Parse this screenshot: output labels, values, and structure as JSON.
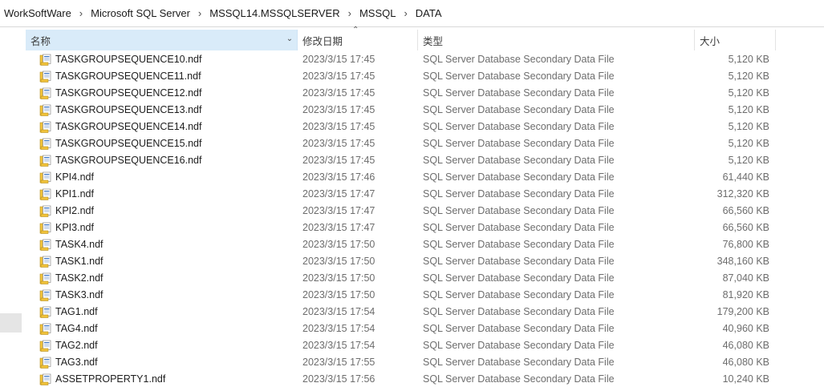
{
  "breadcrumb": [
    "WorkSoftWare",
    "Microsoft SQL Server",
    "MSSQL14.MSSQLSERVER",
    "MSSQL",
    "DATA"
  ],
  "columns": {
    "name": "名称",
    "date": "修改日期",
    "type": "类型",
    "size": "大小"
  },
  "files": [
    {
      "name": "TASKGROUPSEQUENCE10.ndf",
      "date": "2023/3/15 17:45",
      "type": "SQL Server Database Secondary Data File",
      "size": "5,120 KB"
    },
    {
      "name": "TASKGROUPSEQUENCE11.ndf",
      "date": "2023/3/15 17:45",
      "type": "SQL Server Database Secondary Data File",
      "size": "5,120 KB"
    },
    {
      "name": "TASKGROUPSEQUENCE12.ndf",
      "date": "2023/3/15 17:45",
      "type": "SQL Server Database Secondary Data File",
      "size": "5,120 KB"
    },
    {
      "name": "TASKGROUPSEQUENCE13.ndf",
      "date": "2023/3/15 17:45",
      "type": "SQL Server Database Secondary Data File",
      "size": "5,120 KB"
    },
    {
      "name": "TASKGROUPSEQUENCE14.ndf",
      "date": "2023/3/15 17:45",
      "type": "SQL Server Database Secondary Data File",
      "size": "5,120 KB"
    },
    {
      "name": "TASKGROUPSEQUENCE15.ndf",
      "date": "2023/3/15 17:45",
      "type": "SQL Server Database Secondary Data File",
      "size": "5,120 KB"
    },
    {
      "name": "TASKGROUPSEQUENCE16.ndf",
      "date": "2023/3/15 17:45",
      "type": "SQL Server Database Secondary Data File",
      "size": "5,120 KB"
    },
    {
      "name": "KPI4.ndf",
      "date": "2023/3/15 17:46",
      "type": "SQL Server Database Secondary Data File",
      "size": "61,440 KB"
    },
    {
      "name": "KPI1.ndf",
      "date": "2023/3/15 17:47",
      "type": "SQL Server Database Secondary Data File",
      "size": "312,320 KB"
    },
    {
      "name": "KPI2.ndf",
      "date": "2023/3/15 17:47",
      "type": "SQL Server Database Secondary Data File",
      "size": "66,560 KB"
    },
    {
      "name": "KPI3.ndf",
      "date": "2023/3/15 17:47",
      "type": "SQL Server Database Secondary Data File",
      "size": "66,560 KB"
    },
    {
      "name": "TASK4.ndf",
      "date": "2023/3/15 17:50",
      "type": "SQL Server Database Secondary Data File",
      "size": "76,800 KB"
    },
    {
      "name": "TASK1.ndf",
      "date": "2023/3/15 17:50",
      "type": "SQL Server Database Secondary Data File",
      "size": "348,160 KB"
    },
    {
      "name": "TASK2.ndf",
      "date": "2023/3/15 17:50",
      "type": "SQL Server Database Secondary Data File",
      "size": "87,040 KB"
    },
    {
      "name": "TASK3.ndf",
      "date": "2023/3/15 17:50",
      "type": "SQL Server Database Secondary Data File",
      "size": "81,920 KB"
    },
    {
      "name": "TAG1.ndf",
      "date": "2023/3/15 17:54",
      "type": "SQL Server Database Secondary Data File",
      "size": "179,200 KB"
    },
    {
      "name": "TAG4.ndf",
      "date": "2023/3/15 17:54",
      "type": "SQL Server Database Secondary Data File",
      "size": "40,960 KB"
    },
    {
      "name": "TAG2.ndf",
      "date": "2023/3/15 17:54",
      "type": "SQL Server Database Secondary Data File",
      "size": "46,080 KB"
    },
    {
      "name": "TAG3.ndf",
      "date": "2023/3/15 17:55",
      "type": "SQL Server Database Secondary Data File",
      "size": "46,080 KB"
    },
    {
      "name": "ASSETPROPERTY1.ndf",
      "date": "2023/3/15 17:56",
      "type": "SQL Server Database Secondary Data File",
      "size": "10,240 KB"
    }
  ],
  "icons": {
    "header_dropdown": "chevron-down-icon",
    "sort_indicator": "sort-ascending-icon",
    "file": "database-file-icon",
    "crumb_separator": "chevron-right-icon"
  },
  "colors": {
    "header_selected": "#d9ebf9",
    "file_icon_body": "#f0c23b",
    "file_icon_page": "#ffffff",
    "file_icon_accent": "#3a74c4",
    "secondary_text": "#6d6d6d"
  }
}
